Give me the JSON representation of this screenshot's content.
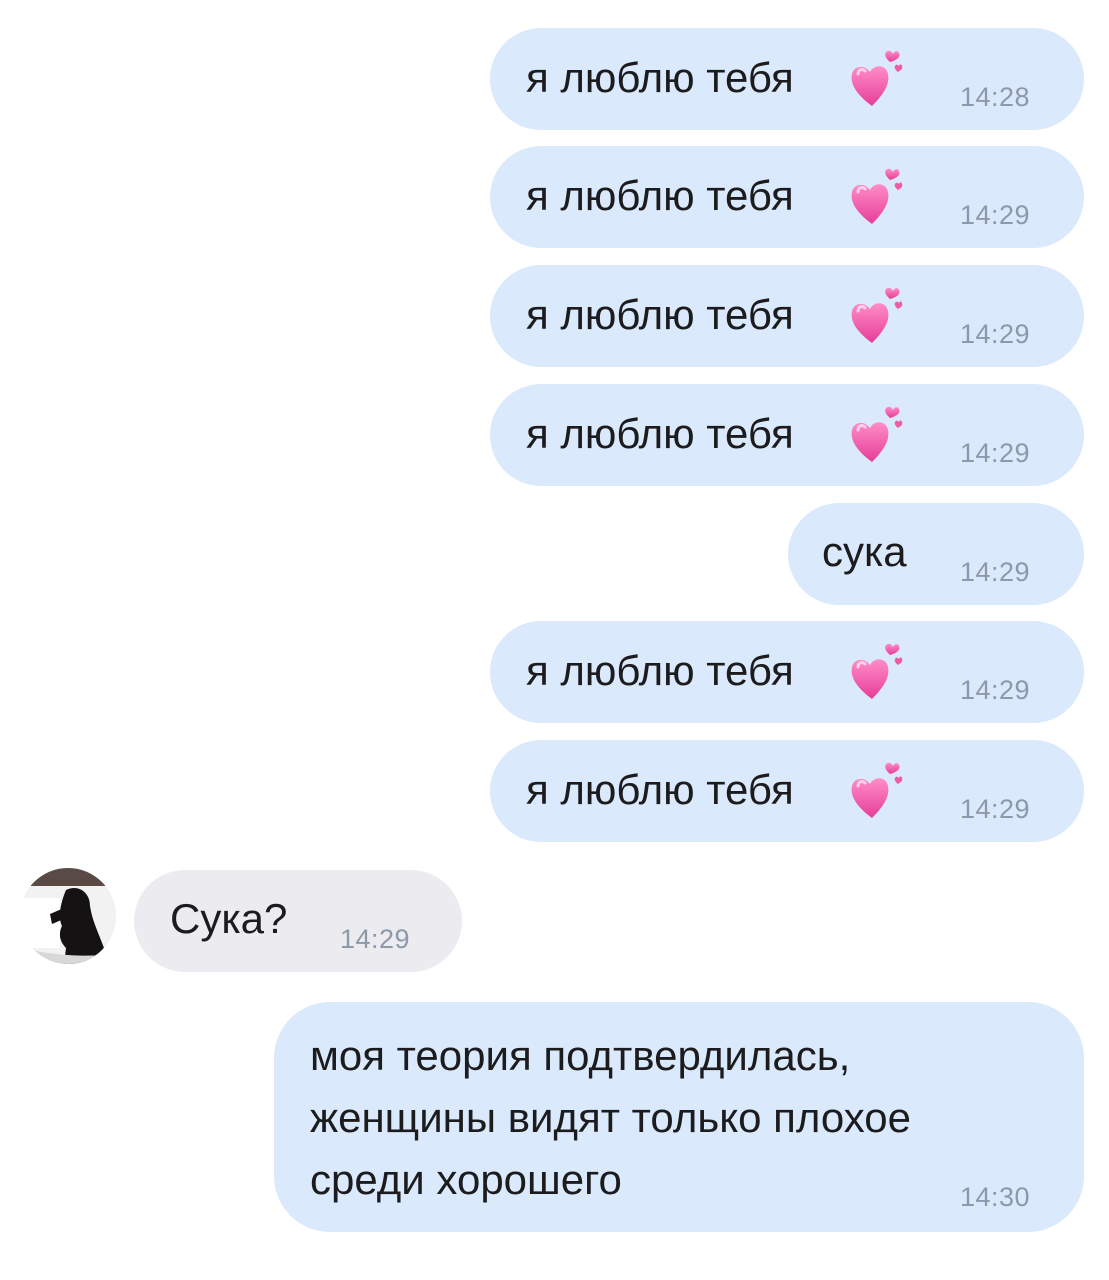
{
  "messages": [
    {
      "text": "я люблю тебя",
      "time": "14:28",
      "emoji": "growing-heart-emoji"
    },
    {
      "text": "я люблю тебя",
      "time": "14:29",
      "emoji": "growing-heart-emoji"
    },
    {
      "text": "я люблю тебя",
      "time": "14:29",
      "emoji": "growing-heart-emoji"
    },
    {
      "text": "я люблю тебя",
      "time": "14:29",
      "emoji": "growing-heart-emoji"
    },
    {
      "text": "сука",
      "time": "14:29"
    },
    {
      "text": "я люблю тебя",
      "time": "14:29",
      "emoji": "growing-heart-emoji"
    },
    {
      "text": "я люблю тебя",
      "time": "14:29",
      "emoji": "growing-heart-emoji"
    },
    {
      "text": "Сука?",
      "time": "14:29"
    },
    {
      "lines": [
        "моя теория подтвердилась,",
        "женщины видят только плохое",
        "среди хорошего"
      ],
      "time": "14:30"
    }
  ],
  "colors": {
    "outgoing_bubble": "#dae9fb",
    "incoming_bubble": "#ececf0",
    "time_text": "#8d99a8",
    "heart": "#f25aa8"
  }
}
